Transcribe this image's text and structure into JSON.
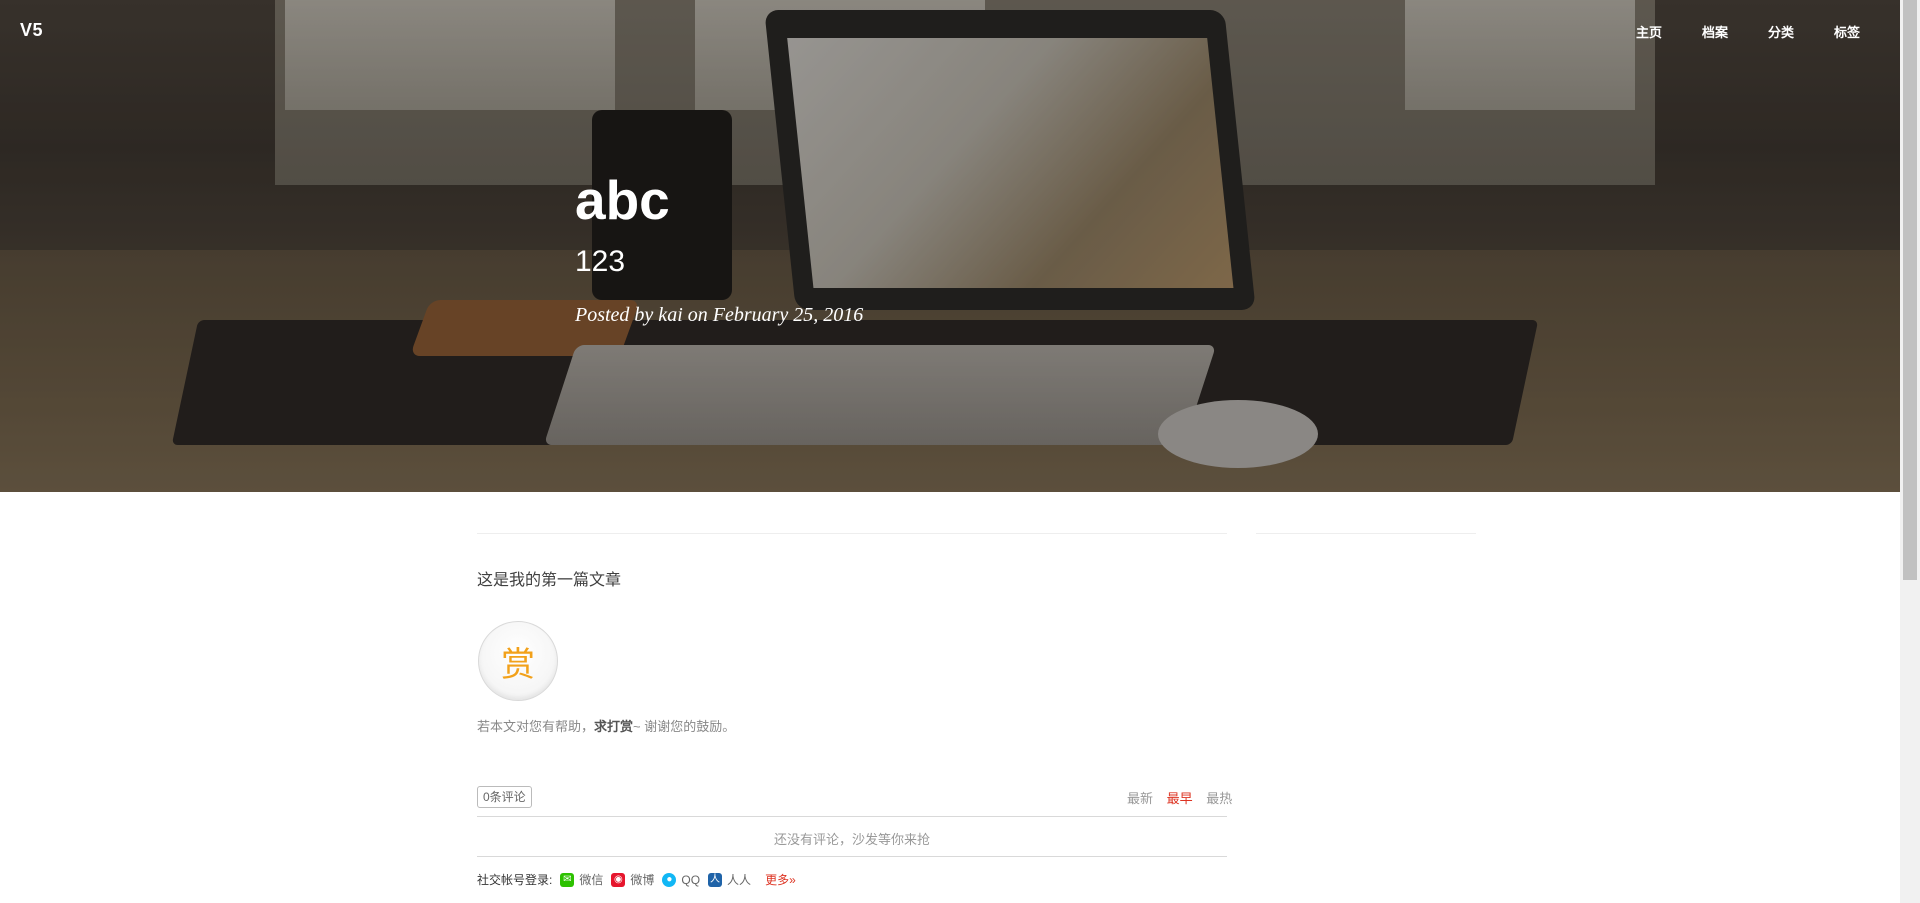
{
  "nav": {
    "brand": "V5",
    "links": [
      "主页",
      "档案",
      "分类",
      "标签"
    ]
  },
  "post": {
    "title": "abc",
    "subtitle": "123",
    "meta": "Posted by kai on February 25, 2016",
    "content": "这是我的第一篇文章"
  },
  "reward": {
    "icon_char": "赏",
    "text_prefix": "若本文对您有帮助，",
    "text_bold": "求打赏",
    "text_suffix": "~ 谢谢您的鼓励。"
  },
  "comments": {
    "count_label": "0条评论",
    "sort_options": [
      "最新",
      "最早",
      "最热"
    ],
    "active_sort": "最早",
    "empty_text": "还没有评论，沙发等你来抢",
    "social_label": "社交帐号登录:",
    "social_items": [
      {
        "name": "微信",
        "icon": "wechat-icon",
        "color": "#2dc100"
      },
      {
        "name": "微博",
        "icon": "weibo-icon",
        "color": "#e6162d"
      },
      {
        "name": "QQ",
        "icon": "qq-icon",
        "color": "#12b7f5"
      },
      {
        "name": "人人",
        "icon": "renren-icon",
        "color": "#1f63a8"
      }
    ],
    "more_label": "更多»"
  },
  "colors": {
    "accent": "#dd3322",
    "reward_icon": "#f2a11a"
  }
}
